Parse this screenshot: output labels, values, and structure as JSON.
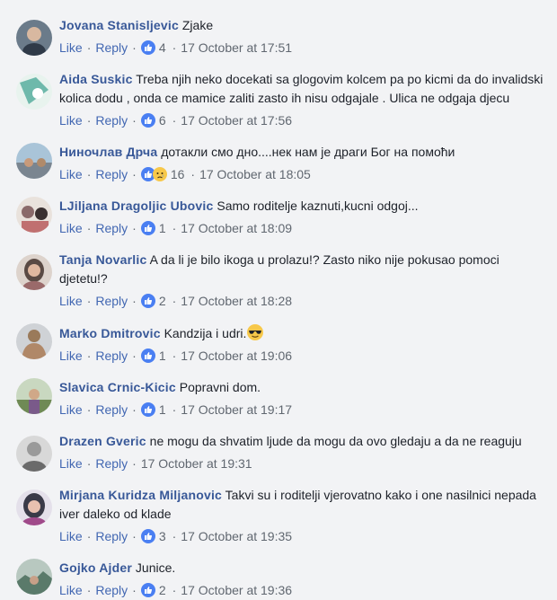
{
  "actions": {
    "like": "Like",
    "reply": "Reply",
    "separator": "·"
  },
  "comments": [
    {
      "author": "Jovana Stanisljevic",
      "text": "Zjake",
      "count": "4",
      "time": "17 October at 17:51",
      "reactions": [
        "like"
      ],
      "avatar": "#6b7b8a"
    },
    {
      "author": "Aida Suskic",
      "text": "Treba njih neko docekati sa glogovim kolcem pa po kicmi da do invalidski kolica dodu , onda ce mamice zaliti zasto ih nisu odgajale . Ulica ne odgaja djecu",
      "count": "6",
      "time": "17 October at 17:56",
      "reactions": [
        "like"
      ],
      "avatar": "#3a9f8f"
    },
    {
      "author": "Ниночлав Дрча",
      "text": "дотакли смо дно....нек нам је драги Бог на помоћи",
      "count": "16",
      "time": "17 October at 18:05",
      "reactions": [
        "like",
        "sad"
      ],
      "avatar": "#7a8590"
    },
    {
      "author": "LJiljana Dragoljic Ubovic",
      "text": "Samo roditelje kaznuti,kucni odgoj...",
      "count": "1",
      "time": "17 October at 18:09",
      "reactions": [
        "like"
      ],
      "avatar": "#8a6a6a"
    },
    {
      "author": "Tanja Novarlic",
      "text": "A da li je bilo ikoga u prolazu!? Zasto niko nije pokusao pomoci djetetu!?",
      "count": "2",
      "time": "17 October at 18:28",
      "reactions": [
        "like"
      ],
      "avatar": "#5a4a44"
    },
    {
      "author": "Marko Dmitrovic",
      "text": "Kandzija i udri.",
      "count": "1",
      "time": "17 October at 19:06",
      "reactions": [
        "like"
      ],
      "avatar": "#9a7a5a",
      "emoji": "cool"
    },
    {
      "author": "Slavica Crnic-Kicic",
      "text": "Popravni dom.",
      "count": "1",
      "time": "17 October at 19:17",
      "reactions": [
        "like"
      ],
      "avatar": "#6f8a55"
    },
    {
      "author": "Drazen Gveric",
      "text": "ne mogu da shvatim ljude da mogu da ovo gledaju a da ne reaguju",
      "count": "",
      "time": "17 October at 19:31",
      "reactions": [],
      "avatar": "#9a9a9a"
    },
    {
      "author": "Mirjana Kuridza Miljanovic",
      "text": "Takvi su i roditelji vjerovatno kako i one nasilnici nepada iver daleko od klade",
      "count": "3",
      "time": "17 October at 19:35",
      "reactions": [
        "like"
      ],
      "avatar": "#3a3a48"
    },
    {
      "author": "Gojko Ajder",
      "text": "Junice.",
      "count": "2",
      "time": "17 October at 19:36",
      "reactions": [
        "like"
      ],
      "avatar": "#5a7a6a"
    }
  ]
}
